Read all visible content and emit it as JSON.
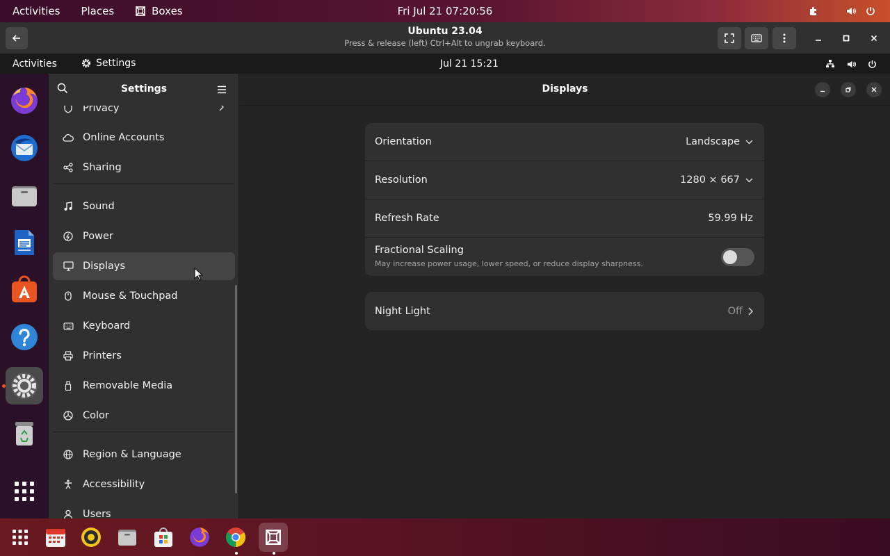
{
  "host_topbar": {
    "activities": "Activities",
    "places": "Places",
    "app_name": "Boxes",
    "clock": "Fri Jul 21  07:20:56",
    "tray": [
      "puzzle-icon",
      "volume-icon",
      "power-icon"
    ]
  },
  "boxes_header": {
    "title": "Ubuntu 23.04",
    "subtitle": "Press & release (left) Ctrl+Alt to ungrab keyboard.",
    "buttons": [
      "back-icon",
      "fullscreen-icon",
      "keyboard-icon",
      "more-icon",
      "minimize-icon",
      "maximize-icon",
      "close-icon"
    ]
  },
  "guest_topbar": {
    "activities": "Activities",
    "app_name": "Settings",
    "clock": "Jul 21  15:21"
  },
  "guest_dock": [
    "firefox",
    "thunderbird",
    "files",
    "libreoffice-writer",
    "app-center",
    "help",
    "settings",
    "trash",
    "show-apps"
  ],
  "settings": {
    "sidebar_title": "Settings",
    "items": [
      {
        "label": "Privacy",
        "icon": "privacy-icon"
      },
      {
        "label": "Online Accounts",
        "icon": "cloud-icon"
      },
      {
        "label": "Sharing",
        "icon": "share-icon"
      },
      {
        "label": "Sound",
        "icon": "music-note-icon"
      },
      {
        "label": "Power",
        "icon": "power-icon"
      },
      {
        "label": "Displays",
        "icon": "monitor-icon"
      },
      {
        "label": "Mouse & Touchpad",
        "icon": "mouse-icon"
      },
      {
        "label": "Keyboard",
        "icon": "keyboard-icon"
      },
      {
        "label": "Printers",
        "icon": "printer-icon"
      },
      {
        "label": "Removable Media",
        "icon": "usb-icon"
      },
      {
        "label": "Color",
        "icon": "color-icon"
      },
      {
        "label": "Region & Language",
        "icon": "globe-icon"
      },
      {
        "label": "Accessibility",
        "icon": "accessibility-icon"
      },
      {
        "label": "Users",
        "icon": "users-icon"
      }
    ],
    "selected": "Displays",
    "page_title": "Displays",
    "rows": {
      "orientation_label": "Orientation",
      "orientation_value": "Landscape",
      "resolution_label": "Resolution",
      "resolution_value": "1280 × 667",
      "refresh_label": "Refresh Rate",
      "refresh_value": "59.99 Hz",
      "scaling_label": "Fractional Scaling",
      "scaling_desc": "May increase power usage, lower speed, or reduce display sharpness.",
      "scaling_on": false,
      "night_label": "Night Light",
      "night_value": "Off"
    }
  },
  "host_dock": [
    "show-apps",
    "calendar",
    "rhythmbox",
    "files",
    "app-center",
    "firefox",
    "chrome",
    "boxes"
  ],
  "colors": {
    "accent": "#e95420",
    "panel": "#303030",
    "background": "#242424"
  }
}
